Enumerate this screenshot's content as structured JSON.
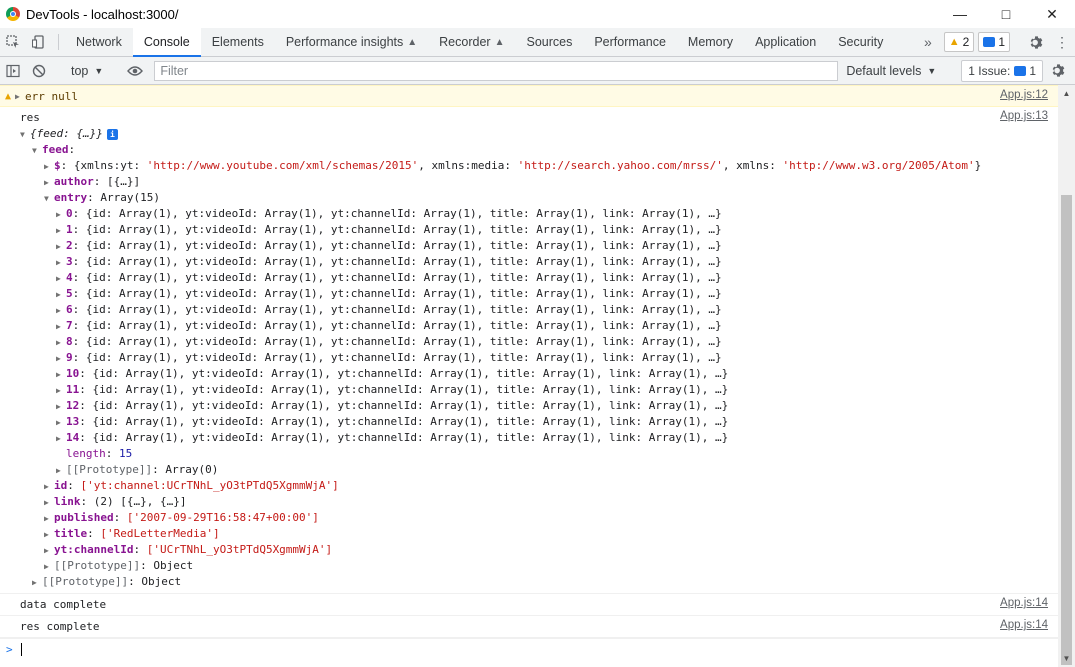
{
  "window": {
    "title": "DevTools - localhost:3000/"
  },
  "tabs": [
    {
      "label": "Network"
    },
    {
      "label": "Console",
      "active": true
    },
    {
      "label": "Elements"
    },
    {
      "label": "Performance insights",
      "experimental": true
    },
    {
      "label": "Recorder",
      "experimental": true
    },
    {
      "label": "Sources"
    },
    {
      "label": "Performance"
    },
    {
      "label": "Memory"
    },
    {
      "label": "Application"
    },
    {
      "label": "Security"
    }
  ],
  "tabbar_right": {
    "more": "»",
    "warnings_count": "2",
    "issues_count": "1"
  },
  "toolbar": {
    "context": "top",
    "filter_placeholder": "Filter",
    "levels": "Default levels",
    "issues_label": "1 Issue:",
    "issues_count": "1"
  },
  "console": {
    "warning": {
      "text": "err null",
      "source": "App.js:12"
    },
    "res_label": "res",
    "res_source": "App.js:13",
    "root_preview": "{feed: {…}}",
    "feed_key": "feed",
    "dollar": {
      "key": "$",
      "value_parts": [
        {
          "t": "plain",
          "v": "{xmlns:yt: "
        },
        {
          "t": "str",
          "v": "'http://www.youtube.com/xml/schemas/2015'"
        },
        {
          "t": "plain",
          "v": ", xmlns:media: "
        },
        {
          "t": "str",
          "v": "'http://search.yahoo.com/mrss/'"
        },
        {
          "t": "plain",
          "v": ", xmlns: "
        },
        {
          "t": "str",
          "v": "'http://www.w3.org/2005/Atom'"
        },
        {
          "t": "plain",
          "v": "}"
        }
      ]
    },
    "author": {
      "key": "author",
      "value": "[{…}]"
    },
    "entry": {
      "key": "entry",
      "value": "Array(15)"
    },
    "entries": [
      {
        "i": "0",
        "v": "{id: Array(1), yt:videoId: Array(1), yt:channelId: Array(1), title: Array(1), link: Array(1), …}"
      },
      {
        "i": "1",
        "v": "{id: Array(1), yt:videoId: Array(1), yt:channelId: Array(1), title: Array(1), link: Array(1), …}"
      },
      {
        "i": "2",
        "v": "{id: Array(1), yt:videoId: Array(1), yt:channelId: Array(1), title: Array(1), link: Array(1), …}"
      },
      {
        "i": "3",
        "v": "{id: Array(1), yt:videoId: Array(1), yt:channelId: Array(1), title: Array(1), link: Array(1), …}"
      },
      {
        "i": "4",
        "v": "{id: Array(1), yt:videoId: Array(1), yt:channelId: Array(1), title: Array(1), link: Array(1), …}"
      },
      {
        "i": "5",
        "v": "{id: Array(1), yt:videoId: Array(1), yt:channelId: Array(1), title: Array(1), link: Array(1), …}"
      },
      {
        "i": "6",
        "v": "{id: Array(1), yt:videoId: Array(1), yt:channelId: Array(1), title: Array(1), link: Array(1), …}"
      },
      {
        "i": "7",
        "v": "{id: Array(1), yt:videoId: Array(1), yt:channelId: Array(1), title: Array(1), link: Array(1), …}"
      },
      {
        "i": "8",
        "v": "{id: Array(1), yt:videoId: Array(1), yt:channelId: Array(1), title: Array(1), link: Array(1), …}"
      },
      {
        "i": "9",
        "v": "{id: Array(1), yt:videoId: Array(1), yt:channelId: Array(1), title: Array(1), link: Array(1), …}"
      },
      {
        "i": "10",
        "v": "{id: Array(1), yt:videoId: Array(1), yt:channelId: Array(1), title: Array(1), link: Array(1), …}"
      },
      {
        "i": "11",
        "v": "{id: Array(1), yt:videoId: Array(1), yt:channelId: Array(1), title: Array(1), link: Array(1), …}"
      },
      {
        "i": "12",
        "v": "{id: Array(1), yt:videoId: Array(1), yt:channelId: Array(1), title: Array(1), link: Array(1), …}"
      },
      {
        "i": "13",
        "v": "{id: Array(1), yt:videoId: Array(1), yt:channelId: Array(1), title: Array(1), link: Array(1), …}"
      },
      {
        "i": "14",
        "v": "{id: Array(1), yt:videoId: Array(1), yt:channelId: Array(1), title: Array(1), link: Array(1), …}"
      }
    ],
    "length": {
      "key": "length",
      "value": "15"
    },
    "array_proto": {
      "key": "[[Prototype]]",
      "value": "Array(0)"
    },
    "id": {
      "key": "id",
      "value": "['yt:channel:UCrTNhL_yO3tPTdQ5XgmmWjA']"
    },
    "link": {
      "key": "link",
      "value": "(2) [{…}, {…}]"
    },
    "published": {
      "key": "published",
      "value": "['2007-09-29T16:58:47+00:00']"
    },
    "title": {
      "key": "title",
      "value": "['RedLetterMedia']"
    },
    "channelId": {
      "key": "yt:channelId",
      "value": "['UCrTNhL_yO3tPTdQ5XgmmWjA']"
    },
    "feed_proto": {
      "key": "[[Prototype]]",
      "value": "Object"
    },
    "root_proto": {
      "key": "[[Prototype]]",
      "value": "Object"
    },
    "data_complete": {
      "text": "data complete",
      "source": "App.js:14"
    },
    "res_complete": {
      "text": "res complete",
      "source": "App.js:14"
    },
    "prompt": ">"
  }
}
